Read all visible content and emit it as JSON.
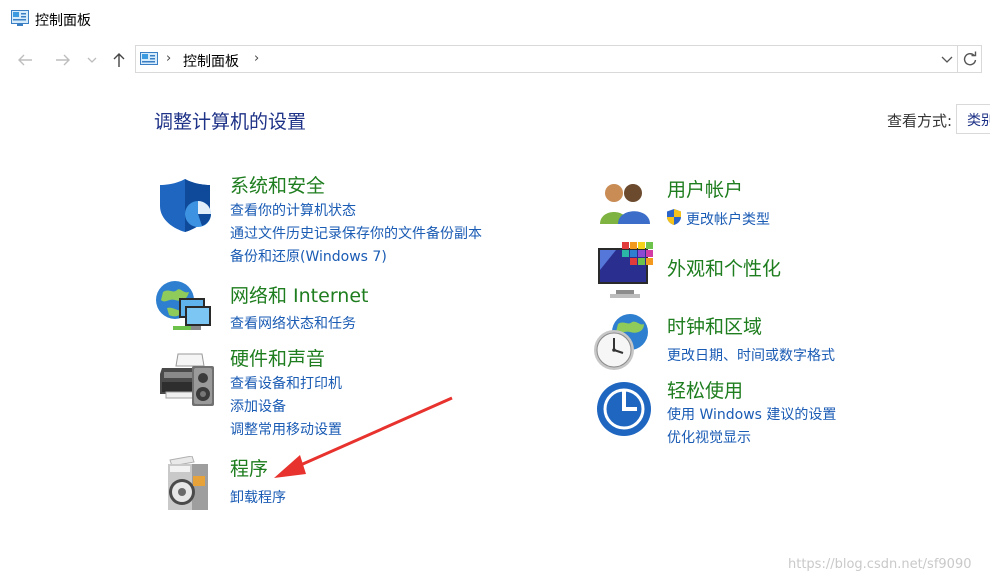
{
  "window": {
    "title": "控制面板"
  },
  "address": {
    "crumb": "控制面板"
  },
  "main": {
    "heading": "调整计算机的设置",
    "view_by_label": "查看方式:",
    "view_by_value": "类别"
  },
  "categories": [
    {
      "title": "系统和安全",
      "icon": "shield-icon",
      "links": [
        "查看你的计算机状态",
        "通过文件历史记录保存你的文件备份副本",
        "备份和还原(Windows 7)"
      ]
    },
    {
      "title": "网络和 Internet",
      "icon": "globe-network-icon",
      "links": [
        "查看网络状态和任务"
      ]
    },
    {
      "title": "硬件和声音",
      "icon": "printer-icon",
      "links": [
        "查看设备和打印机",
        "添加设备",
        "调整常用移动设置"
      ]
    },
    {
      "title": "程序",
      "icon": "programs-disc-icon",
      "links": [
        "卸载程序"
      ]
    },
    {
      "title": "用户帐户",
      "icon": "users-icon",
      "links": [
        "更改帐户类型"
      ]
    },
    {
      "title": "外观和个性化",
      "icon": "monitor-colors-icon",
      "links": []
    },
    {
      "title": "时钟和区域",
      "icon": "clock-globe-icon",
      "links": [
        "更改日期、时间或数字格式"
      ]
    },
    {
      "title": "轻松使用",
      "icon": "ease-of-access-icon",
      "links": [
        "使用 Windows 建议的设置",
        "优化视觉显示"
      ]
    }
  ],
  "watermark": "https://blog.csdn.net/sf9090",
  "colors": {
    "link": "#1a5bb4",
    "category_title": "#1e7d1e",
    "heading": "#1e3287",
    "annotation_arrow": "#e8322d"
  }
}
